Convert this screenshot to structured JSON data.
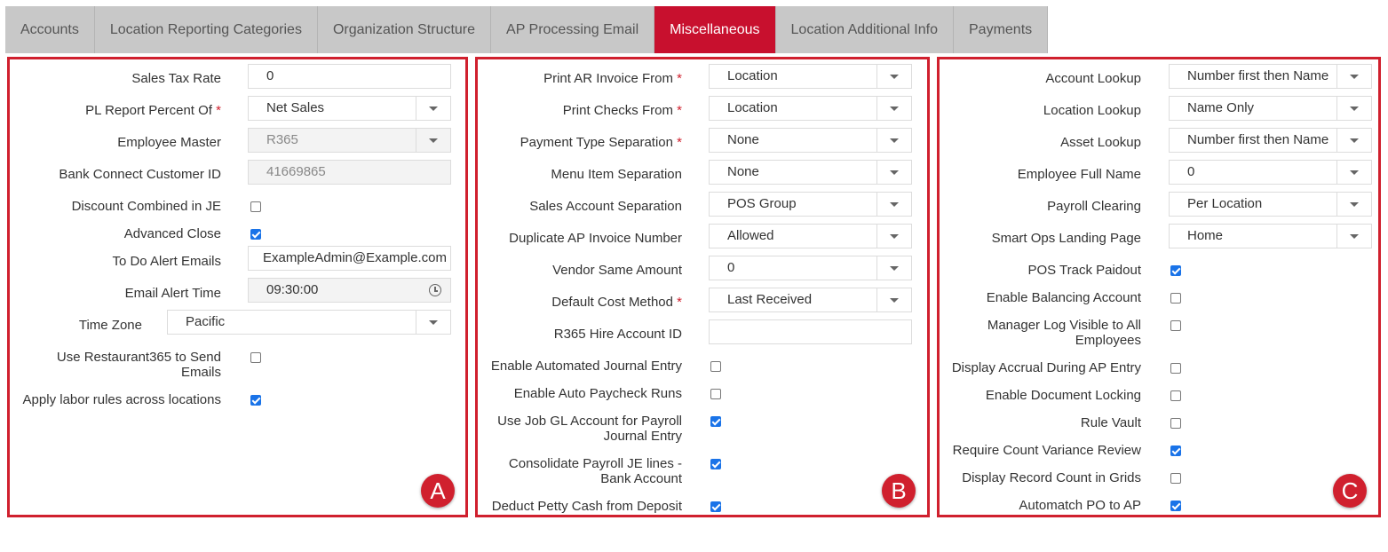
{
  "tabs": [
    {
      "label": "Accounts"
    },
    {
      "label": "Location Reporting Categories"
    },
    {
      "label": "Organization Structure"
    },
    {
      "label": "AP Processing Email"
    },
    {
      "label": "Miscellaneous"
    },
    {
      "label": "Location Additional Info"
    },
    {
      "label": "Payments"
    }
  ],
  "active_tab": "Miscellaneous",
  "panel_a": {
    "badge": "A",
    "sales_tax_rate": {
      "label": "Sales Tax Rate",
      "value": "0"
    },
    "pl_report": {
      "label": "PL Report Percent Of",
      "required": "*",
      "value": "Net Sales"
    },
    "employee_master": {
      "label": "Employee Master",
      "value": "R365"
    },
    "bank_connect": {
      "label": "Bank Connect Customer ID",
      "value": "41669865"
    },
    "discount_combined": {
      "label": "Discount Combined in JE",
      "checked": false
    },
    "advanced_close": {
      "label": "Advanced Close",
      "checked": true
    },
    "todo_alert": {
      "label": "To Do Alert Emails",
      "value": "ExampleAdmin@Example.com"
    },
    "email_alert_time": {
      "label": "Email Alert Time",
      "value": "09:30:00"
    },
    "time_zone": {
      "label": "Time Zone",
      "value": "Pacific"
    },
    "use_r365": {
      "label1": "Use Restaurant365 to Send",
      "label2": "Emails",
      "checked": false
    },
    "apply_labor": {
      "label": "Apply labor rules across locations",
      "checked": true
    }
  },
  "panel_b": {
    "badge": "B",
    "print_ar": {
      "label": "Print AR Invoice From",
      "required": "*",
      "value": "Location"
    },
    "print_checks": {
      "label": "Print Checks From",
      "required": "*",
      "value": "Location"
    },
    "payment_type": {
      "label": "Payment Type Separation",
      "required": "*",
      "value": "None"
    },
    "menu_item": {
      "label": "Menu Item Separation",
      "value": "None"
    },
    "sales_account": {
      "label": "Sales Account Separation",
      "value": "POS Group"
    },
    "duplicate_ap": {
      "label": "Duplicate AP Invoice Number",
      "value": "Allowed"
    },
    "vendor_same": {
      "label": "Vendor Same Amount",
      "value": "0"
    },
    "default_cost": {
      "label": "Default Cost Method",
      "required": "*",
      "value": "Last Received"
    },
    "r365_hire": {
      "label": "R365 Hire Account ID",
      "value": ""
    },
    "auto_journal": {
      "label": "Enable Automated Journal Entry",
      "checked": false
    },
    "auto_paycheck": {
      "label": "Enable Auto Paycheck Runs",
      "checked": false
    },
    "job_gl": {
      "label1": "Use Job GL Account for Payroll",
      "label2": "Journal Entry",
      "checked": true
    },
    "consolidate": {
      "label1": "Consolidate Payroll JE lines -",
      "label2": "Bank Account",
      "checked": true
    },
    "petty_cash": {
      "label": "Deduct Petty Cash from Deposit",
      "checked": true
    }
  },
  "panel_c": {
    "badge": "C",
    "account_lookup": {
      "label": "Account Lookup",
      "value": "Number first then Name"
    },
    "location_lookup": {
      "label": "Location Lookup",
      "value": "Name Only"
    },
    "asset_lookup": {
      "label": "Asset Lookup",
      "value": "Number first then Name"
    },
    "employee_full_name": {
      "label": "Employee Full Name",
      "value": "0"
    },
    "payroll_clearing": {
      "label": "Payroll Clearing",
      "value": "Per Location"
    },
    "smart_ops": {
      "label": "Smart Ops Landing Page",
      "value": "Home"
    },
    "pos_track": {
      "label": "POS Track Paidout",
      "checked": true
    },
    "balancing": {
      "label": "Enable Balancing Account",
      "checked": false
    },
    "manager_log": {
      "label1": "Manager Log Visible to All",
      "label2": "Employees",
      "checked": false
    },
    "accrual": {
      "label": "Display Accrual During AP Entry",
      "checked": false
    },
    "doc_locking": {
      "label": "Enable Document Locking",
      "checked": false
    },
    "rule_vault": {
      "label": "Rule Vault",
      "checked": false
    },
    "count_variance": {
      "label": "Require Count Variance Review",
      "checked": true
    },
    "record_count": {
      "label": "Display Record Count in Grids",
      "checked": false
    },
    "automatch": {
      "label": "Automatch PO to AP",
      "checked": true
    }
  },
  "colors": {
    "accent": "#d0202e",
    "active_tab": "#c8102e",
    "checkbox": "#1a73e8",
    "tab_bg": "#c8c8c8"
  },
  "icons": {
    "dropdown": "chevron-down-icon",
    "time": "clock-icon"
  }
}
